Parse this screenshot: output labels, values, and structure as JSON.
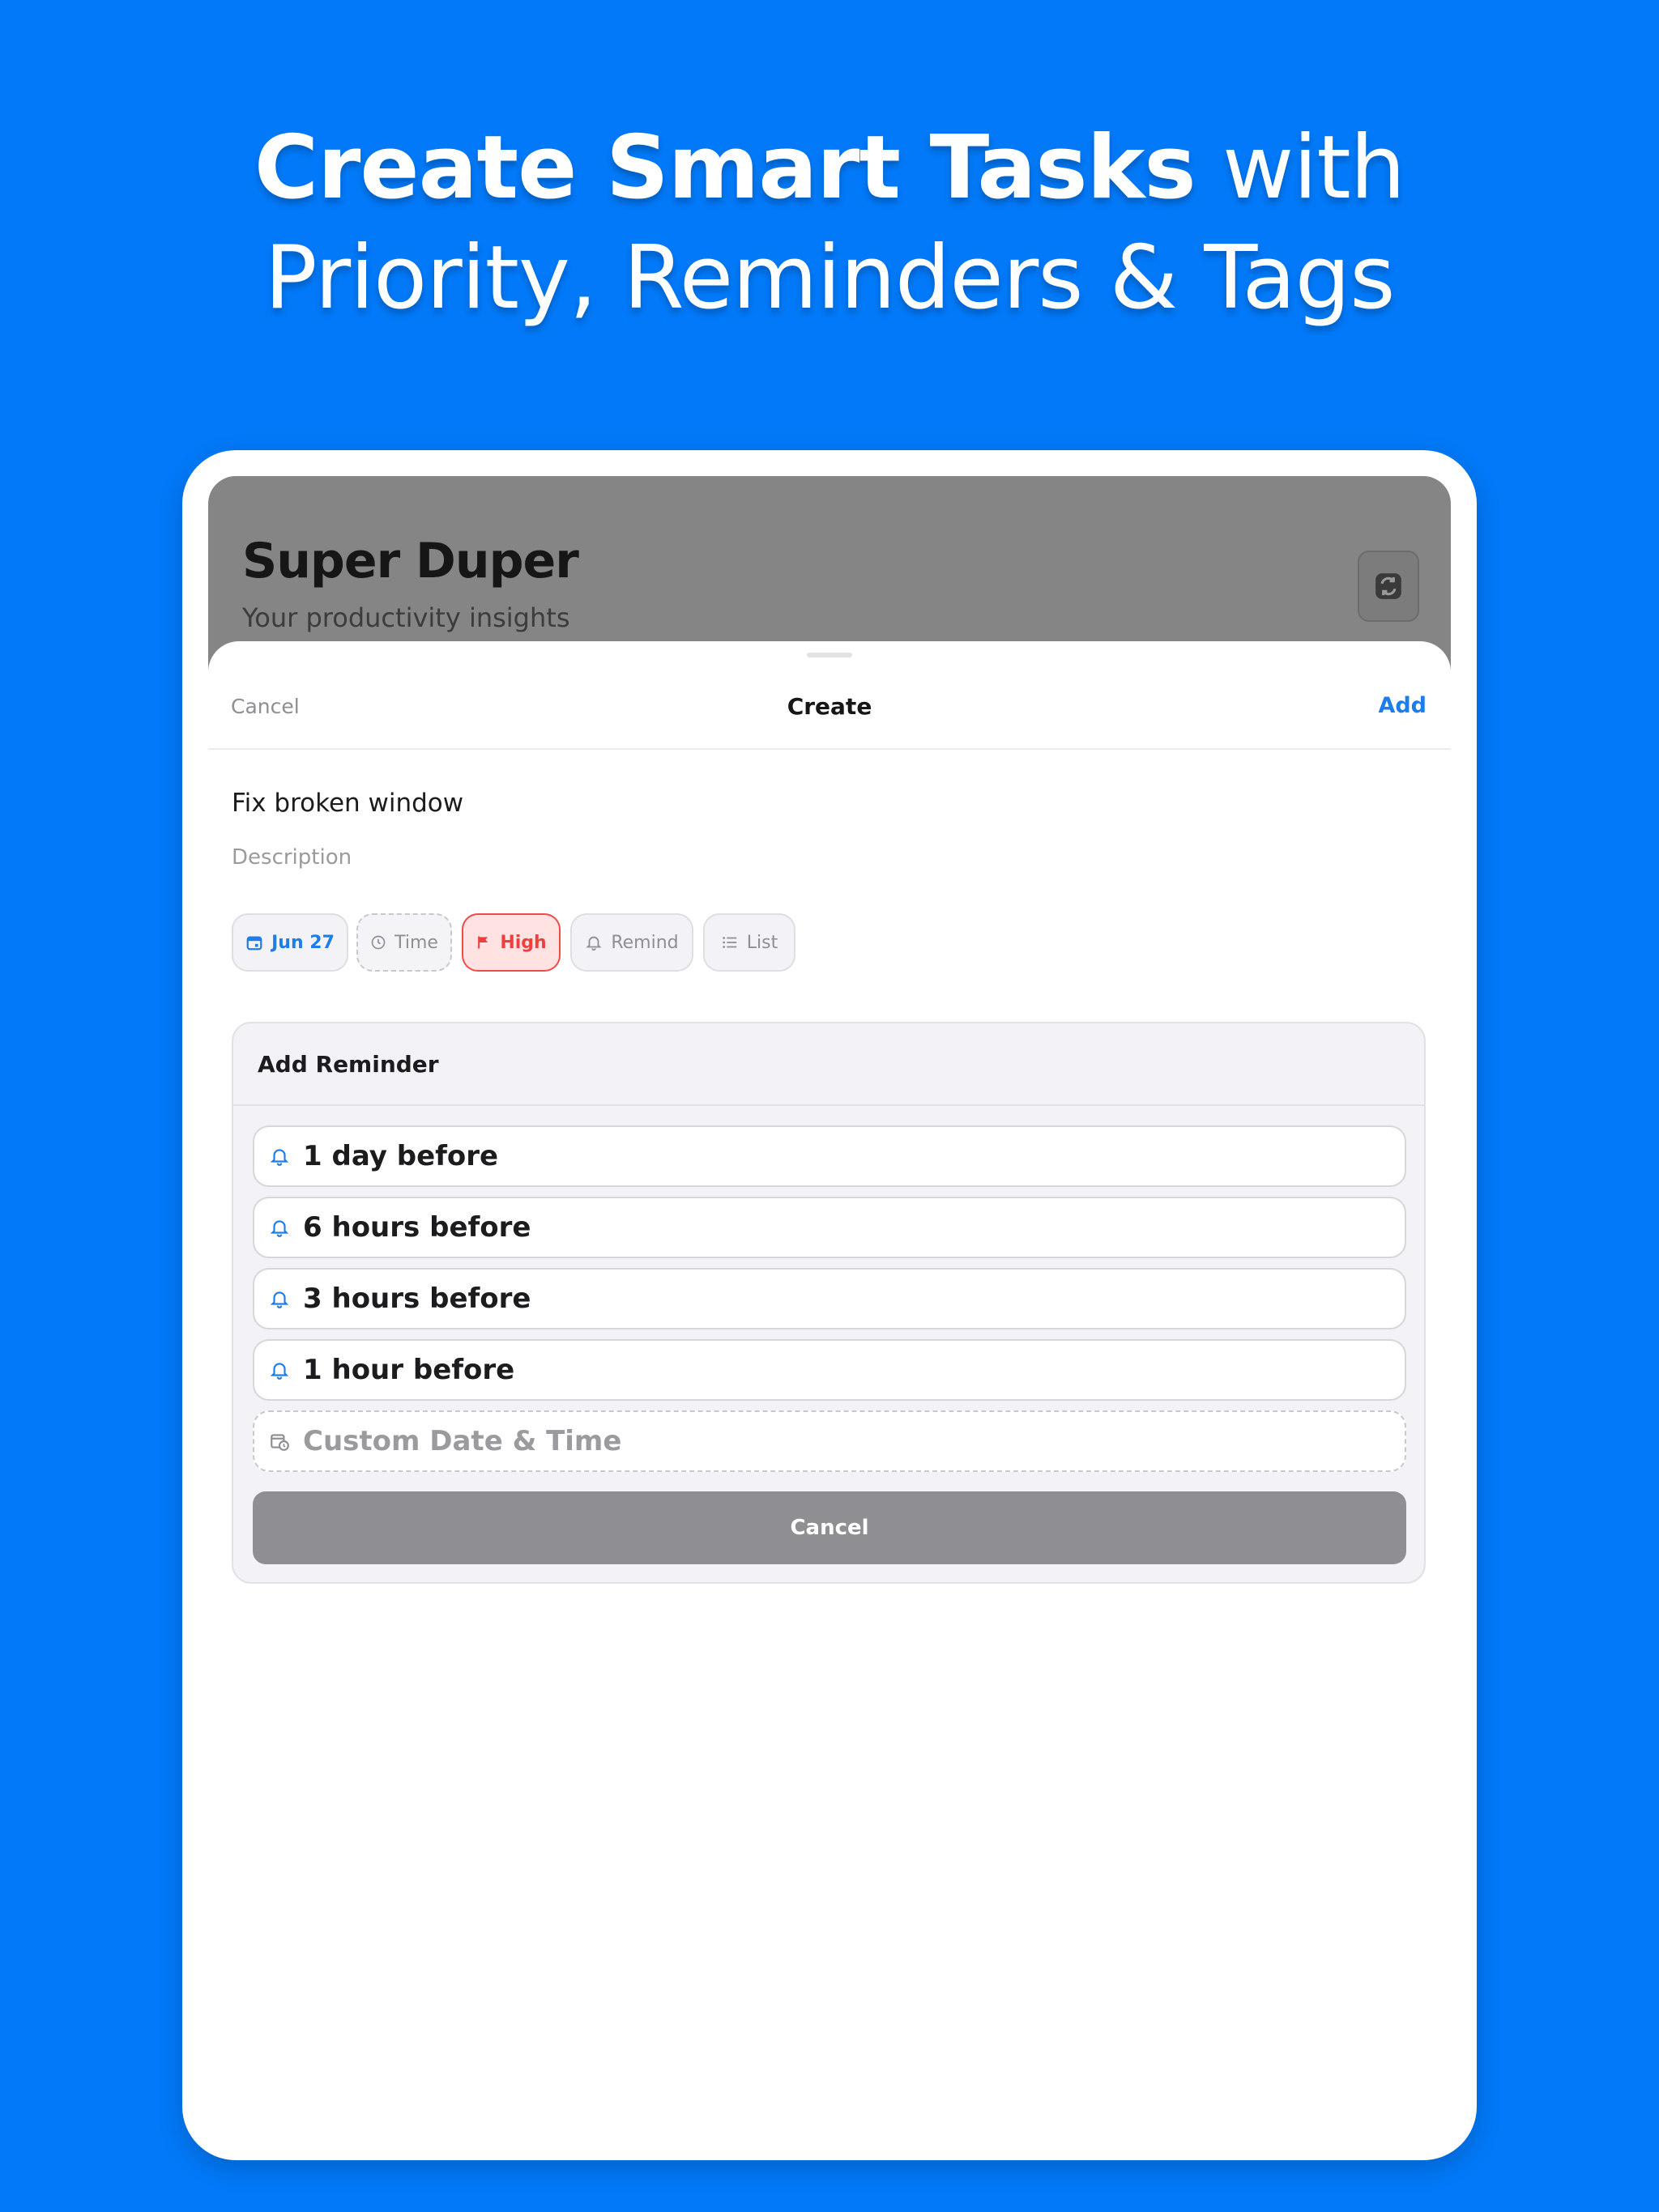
{
  "hero": {
    "title_bold": "Create Smart Tasks",
    "title_rest": " with",
    "line2": "Priority, Reminders & Tags"
  },
  "background_app": {
    "title": "Super Duper",
    "subtitle": "Your productivity insights",
    "refresh_icon": "refresh-icon"
  },
  "sheet": {
    "cancel_label": "Cancel",
    "title": "Create",
    "add_label": "Add",
    "task_title": "Fix broken window",
    "description_placeholder": "Description"
  },
  "chips": {
    "date": "Jun 27",
    "time": "Time",
    "priority": "High",
    "remind": "Remind",
    "list": "List"
  },
  "reminder": {
    "header": "Add Reminder",
    "options": [
      "1 day before",
      "6 hours before",
      "3 hours before",
      "1 hour before"
    ],
    "custom": "Custom Date & Time",
    "cancel_label": "Cancel"
  },
  "colors": {
    "brand_blue": "#0279F8",
    "accent": "#1e7de8",
    "priority_high": "#ef3e3e",
    "muted": "#8e8e93"
  }
}
